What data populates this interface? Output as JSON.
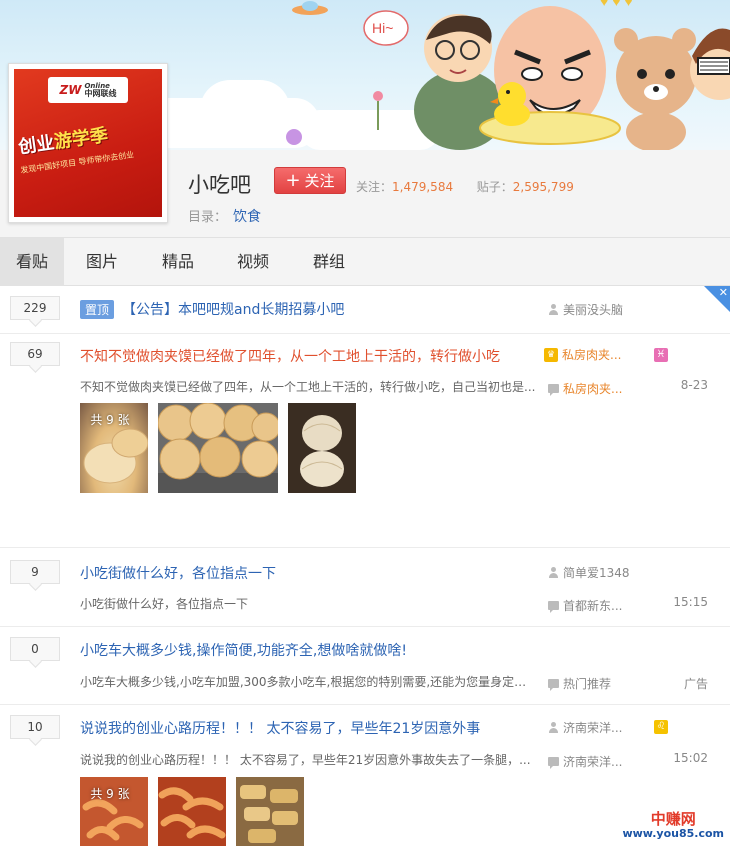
{
  "forum": {
    "name": "小吃吧",
    "follow_label": "关注",
    "follow_plus": "+",
    "followers_label": "关注：",
    "followers": "1,479,584",
    "posts_label": "贴子：",
    "posts": "2,595,799",
    "category_label": "目录：",
    "category": "饮食"
  },
  "banner": {
    "hi_text": "Hi~"
  },
  "avatar": {
    "logo_mark": "ZW",
    "logo_online": "Online",
    "logo_name": "中网联线",
    "title_a": "创业",
    "title_b": "游学季",
    "sub": "发现中国好项目 导师带你去创业"
  },
  "tabs": [
    "看贴",
    "图片",
    "精品",
    "视频",
    "群组"
  ],
  "threads": [
    {
      "replies": "229",
      "pin": "置顶",
      "title": "【公告】本吧吧规and长期招募小吧",
      "author": "美丽没头脑"
    },
    {
      "replies": "69",
      "title": "不知不觉做肉夹馍已经做了四年，从一个工地上干活的，转行做小吃",
      "excerpt": "不知不觉做肉夹馍已经做了四年，从一个工地上干活的，转行做小吃，自己当初也是...",
      "author": "私房肉夹...",
      "last_reply": "私房肉夹...",
      "time": "8-23",
      "badge": "♓",
      "image_count": "共 9 张"
    },
    {
      "replies": "9",
      "title": "小吃街做什么好，各位指点一下",
      "excerpt": "小吃街做什么好，各位指点一下",
      "author": "简单爱1348",
      "last_reply": "首都新东...",
      "time": "15:15"
    },
    {
      "replies": "0",
      "title": "小吃车大概多少钱,操作简便,功能齐全,想做啥就做啥!",
      "excerpt": "小吃车大概多少钱,小吃车加盟,300多款小吃车,根据您的特别需要,还能为您量身定制...",
      "last_reply": "热门推荐",
      "time": "广告"
    },
    {
      "replies": "10",
      "title": "说说我的创业心路历程！！！ 太不容易了，早些年21岁因意外事",
      "excerpt": "说说我的创业心路历程！！！ 太不容易了，早些年21岁因意外事故失去了一条腿，...",
      "author": "济南荣洋...",
      "last_reply": "济南荣洋...",
      "time": "15:02",
      "badge": "♌",
      "image_count": "共 9 张"
    }
  ],
  "watermark": {
    "cn": "中赚网",
    "url": "www.you85.com"
  }
}
